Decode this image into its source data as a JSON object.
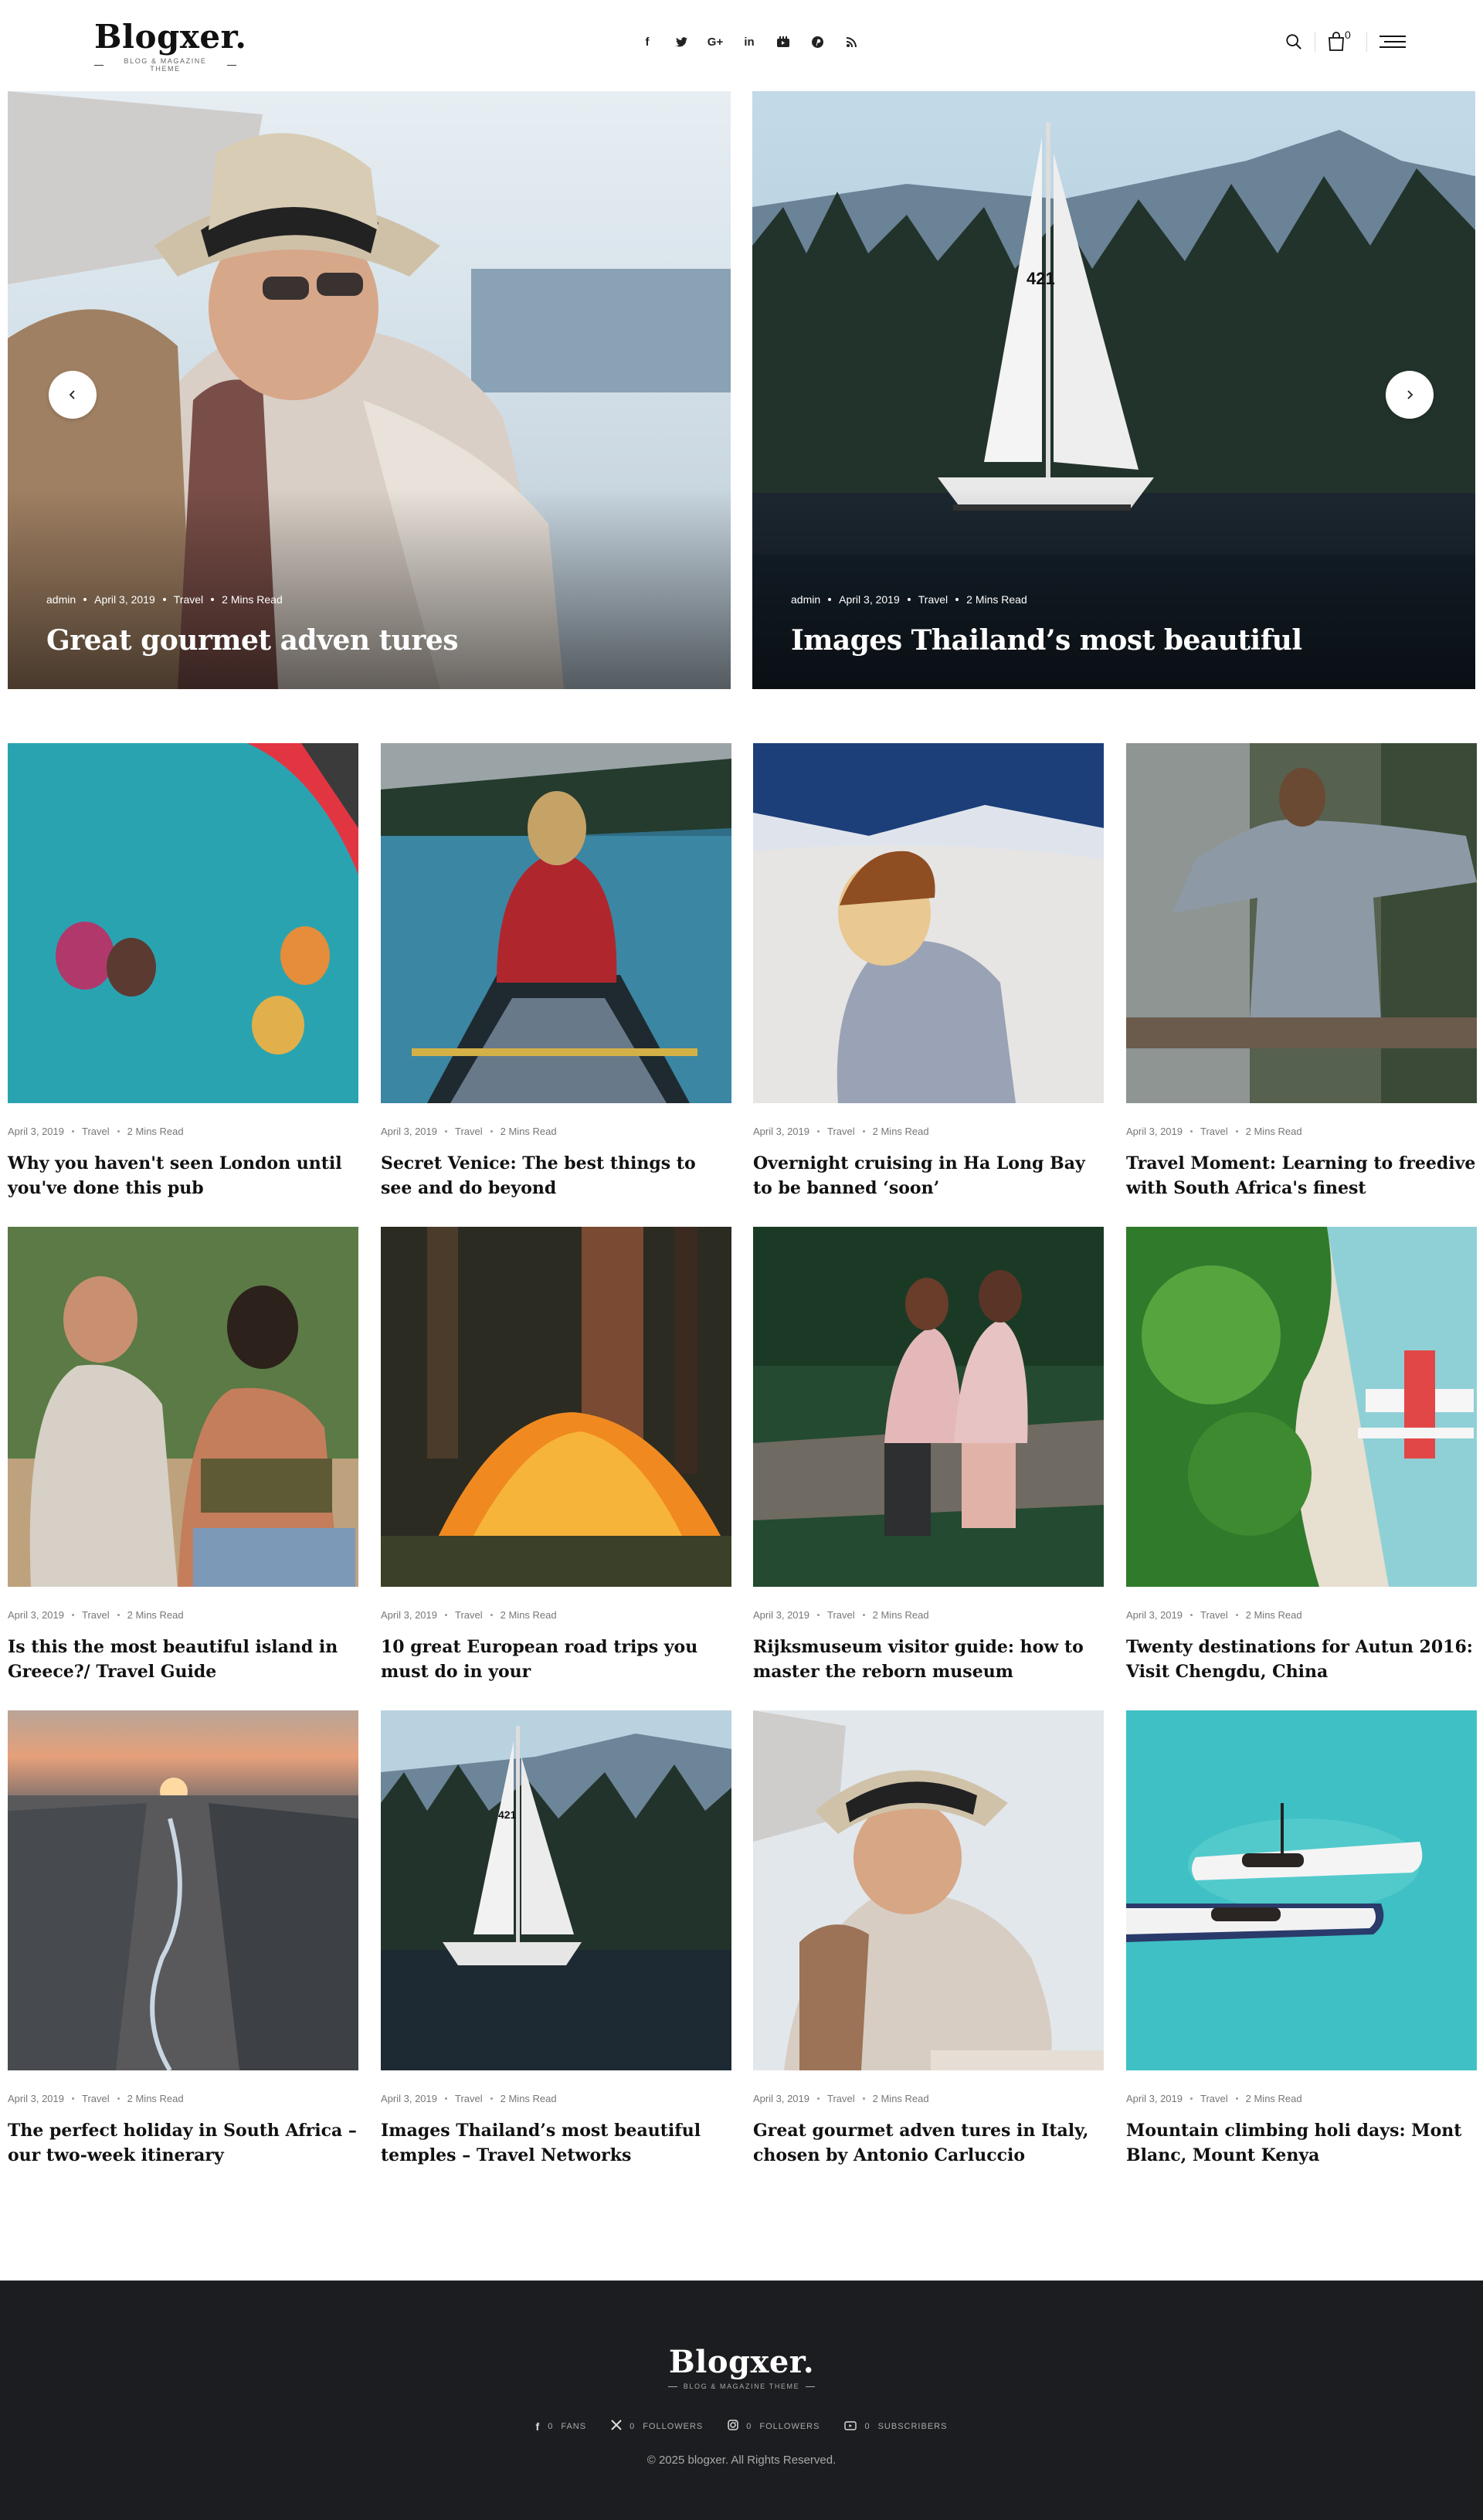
{
  "header": {
    "logo": "Blogxer.",
    "tagline": "BLOG & MAGAZINE THEME",
    "social": [
      "f",
      "t",
      "G+",
      "in",
      "yt",
      "p",
      "rss"
    ],
    "cart_count": "0"
  },
  "slider": {
    "prev_label": "‹",
    "next_label": "›",
    "slides": [
      {
        "author": "admin",
        "date": "April 3, 2019",
        "category": "Travel",
        "read": "2 Mins Read",
        "title": "Great gourmet adven tures"
      },
      {
        "author": "admin",
        "date": "April 3, 2019",
        "category": "Travel",
        "read": "2 Mins Read",
        "title": "Images Thailand’s most beautiful"
      }
    ]
  },
  "posts": [
    {
      "date": "April 3, 2019",
      "category": "Travel",
      "read": "2 Mins Read",
      "title": "Why you haven't seen London until you've done this pub"
    },
    {
      "date": "April 3, 2019",
      "category": "Travel",
      "read": "2 Mins Read",
      "title": "Secret Venice: The best things to see and do beyond"
    },
    {
      "date": "April 3, 2019",
      "category": "Travel",
      "read": "2 Mins Read",
      "title": "Overnight cruising in Ha Long Bay to be banned ‘soon’"
    },
    {
      "date": "April 3, 2019",
      "category": "Travel",
      "read": "2 Mins Read",
      "title": "Travel Moment: Learning to freedive with South Africa's finest"
    },
    {
      "date": "April 3, 2019",
      "category": "Travel",
      "read": "2 Mins Read",
      "title": "Is this the most beautiful island in Greece?/ Travel Guide"
    },
    {
      "date": "April 3, 2019",
      "category": "Travel",
      "read": "2 Mins Read",
      "title": "10 great European road trips you must do in your"
    },
    {
      "date": "April 3, 2019",
      "category": "Travel",
      "read": "2 Mins Read",
      "title": "Rijksmuseum visitor guide: how to master the reborn museum"
    },
    {
      "date": "April 3, 2019",
      "category": "Travel",
      "read": "2 Mins Read",
      "title": "Twenty destinations for Autun 2016: Visit Chengdu, China"
    },
    {
      "date": "April 3, 2019",
      "category": "Travel",
      "read": "2 Mins Read",
      "title": "The perfect holiday in South Africa – our two-week itinerary"
    },
    {
      "date": "April 3, 2019",
      "category": "Travel",
      "read": "2 Mins Read",
      "title": "Images Thailand’s most beautiful temples – Travel Networks"
    },
    {
      "date": "April 3, 2019",
      "category": "Travel",
      "read": "2 Mins Read",
      "title": "Great gourmet adven tures in Italy, chosen by Antonio Carluccio"
    },
    {
      "date": "April 3, 2019",
      "category": "Travel",
      "read": "2 Mins Read",
      "title": "Mountain climbing holi days: Mont Blanc, Mount Kenya"
    }
  ],
  "footer": {
    "logo": "Blogxer.",
    "tagline": "BLOG & MAGAZINE THEME",
    "stats": [
      {
        "icon": "facebook-icon",
        "count": "0",
        "label": "FANS"
      },
      {
        "icon": "x-icon",
        "count": "0",
        "label": "FOLLOWERS"
      },
      {
        "icon": "instagram-icon",
        "count": "0",
        "label": "FOLLOWERS"
      },
      {
        "icon": "youtube-icon",
        "count": "0",
        "label": "SUBSCRIBERS"
      }
    ],
    "copyright": "© 2025 blogxer. All Rights Reserved."
  }
}
